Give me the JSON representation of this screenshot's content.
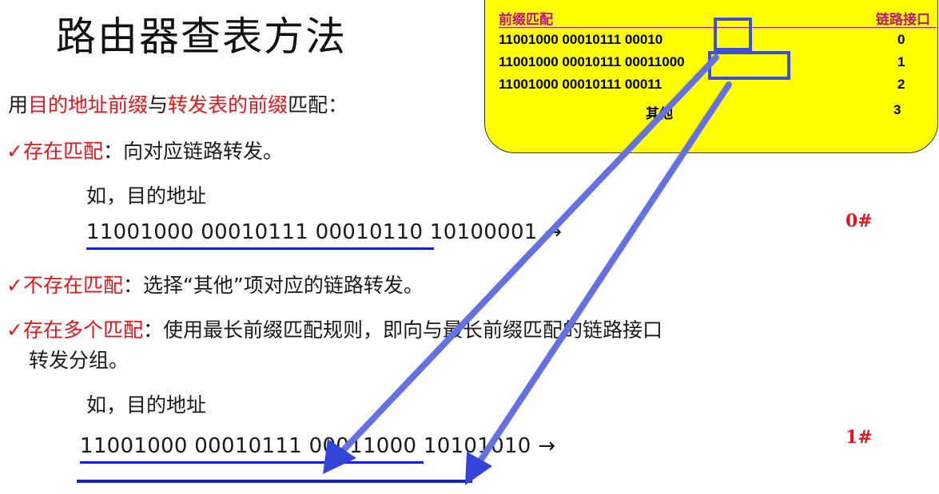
{
  "title": "路由器查表方法",
  "intro": {
    "p1": "用",
    "r1": "目的地址前缀",
    "p2": "与",
    "r2": "转发表的前缀",
    "p3": "匹配："
  },
  "case1": {
    "check": "✓",
    "label": "存在匹配",
    "text": "：向对应链路转发。"
  },
  "example1": {
    "intro": "如，目的地址",
    "address": "11001000  00010111  00010110  10100001  →",
    "result": "0#"
  },
  "case2": {
    "check": "✓",
    "label": "不存在匹配",
    "text": "：选择“其他”项对应的链路转发。"
  },
  "case3": {
    "check": "✓",
    "label": "存在多个匹配",
    "text": "：使用最长前缀匹配规则，即向与最长前缀匹配的链路接口",
    "text2": "转发分组。"
  },
  "example2": {
    "intro": "如，目的地址",
    "address": "11001000  00010111  00011000  10101010  →",
    "result": "1#"
  },
  "table": {
    "header_prefix": "前缀匹配",
    "header_iface": "链路接口",
    "rows": [
      {
        "prefix": "11001000 00010111 00010",
        "iface": "0"
      },
      {
        "prefix": "11001000 00010111 00011000",
        "iface": "1"
      },
      {
        "prefix": "11001000 00010111 00011",
        "iface": "2"
      },
      {
        "prefix": "其他",
        "iface": "3"
      }
    ],
    "bg_color": "#ffff00",
    "header_color": "#c0127f"
  },
  "colors": {
    "highlight": "#e8141b",
    "arrow": "#3d4fd8",
    "underline": "#1320d6"
  }
}
